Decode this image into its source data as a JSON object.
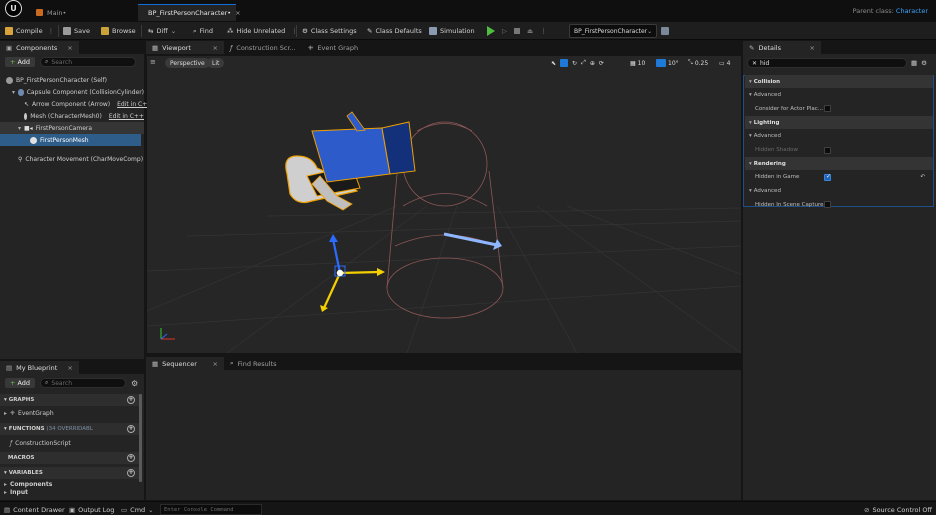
{
  "titlebar": {
    "tabs": [
      {
        "label": "Main•",
        "active": false
      },
      {
        "label": "BP_FirstPersonCharacter•",
        "active": true
      }
    ],
    "parent_class_label": "Parent class:",
    "parent_class_value": "Character"
  },
  "toolbar": {
    "compile": "Compile",
    "save": "Save",
    "browse": "Browse",
    "diff": "Diff",
    "find": "Find",
    "hide_unrelated": "Hide Unrelated",
    "class_settings": "Class Settings",
    "class_defaults": "Class Defaults",
    "simulation": "Simulation",
    "debug_object": "BP_FirstPersonCharacter"
  },
  "components": {
    "tab": "Components",
    "add_label": "Add",
    "search_placeholder": "Search",
    "items": [
      {
        "label": "BP_FirstPersonCharacter (Self)",
        "edit": ""
      },
      {
        "label": "Capsule Component (CollisionCylinder)",
        "edit": ""
      },
      {
        "label": "Arrow Component (Arrow)",
        "edit": "Edit in C++"
      },
      {
        "label": "Mesh (CharacterMesh0)",
        "edit": "Edit in C++"
      },
      {
        "label": "FirstPersonCamera",
        "edit": ""
      },
      {
        "label": "FirstPersonMesh",
        "edit": ""
      },
      {
        "label": "Character Movement (CharMoveComp)",
        "edit": ""
      }
    ]
  },
  "center_tabs": [
    {
      "label": "Viewport",
      "active": true
    },
    {
      "label": "Construction Scr...",
      "active": false
    },
    {
      "label": "Event Graph",
      "active": false
    }
  ],
  "viewport": {
    "perspective": "Perspective",
    "lit": "Lit",
    "grid_value": "10",
    "angle_value": "10°",
    "scale_value": "0.25",
    "camera_speed": "4"
  },
  "bottom_tabs": {
    "sequencer": "Sequencer",
    "find_results": "Find Results"
  },
  "my_blueprint": {
    "tab": "My Blueprint",
    "add_label": "Add",
    "search_placeholder": "Search",
    "graphs_header": "GRAPHS",
    "event_graph": "EventGraph",
    "functions_header": "FUNCTIONS",
    "functions_overridable": "(34 OVERRIDABL",
    "construction_script": "ConstructionScript",
    "macros_header": "MACROS",
    "variables_header": "VARIABLES",
    "variables_components": "Components",
    "variables_input": "Input"
  },
  "details": {
    "tab": "Details",
    "search_value": "hid",
    "rows": [
      {
        "type": "cat",
        "label": "Collision",
        "checkbox": "",
        "dim": false
      },
      {
        "type": "sub",
        "label": "Advanced",
        "checkbox": "",
        "dim": false
      },
      {
        "type": "prop",
        "label": "Consider for Actor Plac...",
        "checkbox": "off",
        "dim": false
      },
      {
        "type": "cat",
        "label": "Lighting",
        "checkbox": "",
        "dim": false
      },
      {
        "type": "sub",
        "label": "Advanced",
        "checkbox": "",
        "dim": false
      },
      {
        "type": "prop",
        "label": "Hidden Shadow",
        "checkbox": "off",
        "dim": true
      },
      {
        "type": "cat",
        "label": "Rendering",
        "checkbox": "",
        "dim": false
      },
      {
        "type": "prop",
        "label": "Hidden in Game",
        "checkbox": "on",
        "dim": false
      },
      {
        "type": "sub",
        "label": "Advanced",
        "checkbox": "",
        "dim": false
      },
      {
        "type": "prop",
        "label": "Hidden In Scene Capture",
        "checkbox": "off",
        "dim": false
      }
    ]
  },
  "statusbar": {
    "content_drawer": "Content Drawer",
    "output_log": "Output Log",
    "cmd": "Cmd",
    "console_placeholder": "Enter Console Command",
    "source_control": "Source Control Off"
  },
  "colors": {
    "accent": "#0f6fd6",
    "selection": "#2f5d8a",
    "play": "#4fbf3f"
  }
}
